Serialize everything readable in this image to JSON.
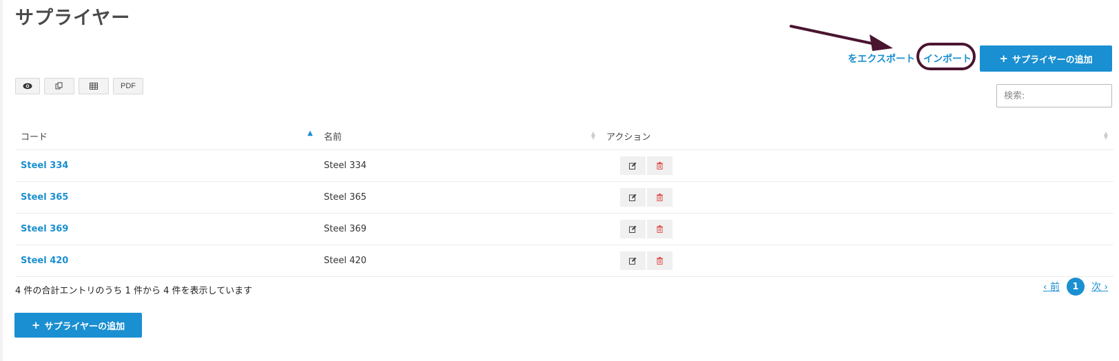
{
  "page": {
    "title": "サプライヤー"
  },
  "top_actions": {
    "export_label": "をエクスポート",
    "import_label": "インポート",
    "add_label": "サプライヤーの追加"
  },
  "toolbar": [
    {
      "name": "view-toggle-button",
      "icon": "eye-icon",
      "label": ""
    },
    {
      "name": "copy-button",
      "icon": "copy-icon",
      "label": ""
    },
    {
      "name": "excel-button",
      "icon": "table-icon",
      "label": ""
    },
    {
      "name": "pdf-button",
      "icon": "",
      "label": "PDF"
    }
  ],
  "search": {
    "placeholder": "検索:"
  },
  "table": {
    "columns": [
      "コード",
      "名前",
      "アクション"
    ],
    "rows": [
      {
        "code": "Steel 334",
        "name": "Steel 334"
      },
      {
        "code": "Steel 365",
        "name": "Steel 365"
      },
      {
        "code": "Steel 369",
        "name": "Steel 369"
      },
      {
        "code": "Steel 420",
        "name": "Steel 420"
      }
    ]
  },
  "footer": {
    "info": "4 件の合計エントリのうち 1 件から 4 件を表示しています",
    "prev_label": "前",
    "current_page": "1",
    "next_label": "次",
    "add_label": "サプライヤーの追加"
  },
  "colors": {
    "accent": "#1a8fd1",
    "annotation": "#4a1530",
    "delete": "#e05050"
  }
}
